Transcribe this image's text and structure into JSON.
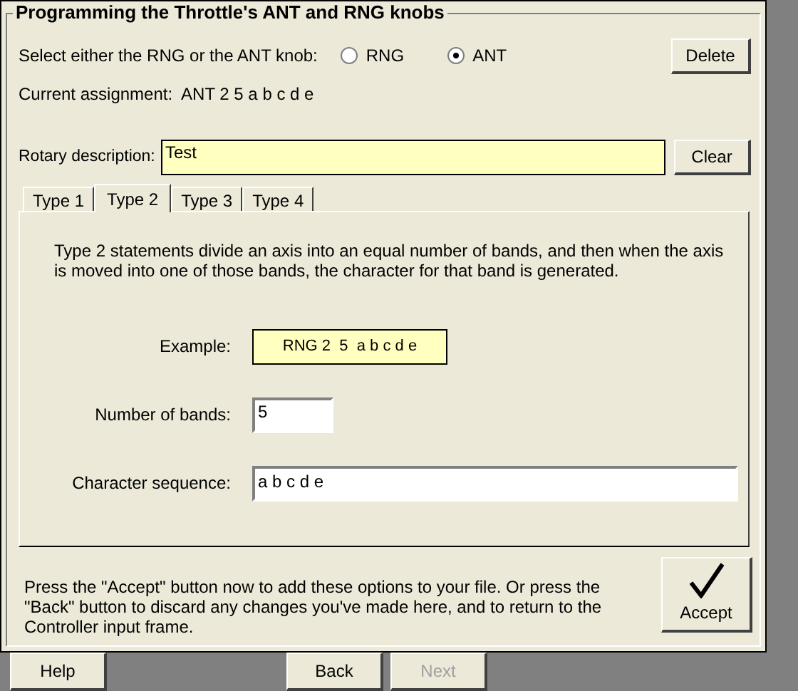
{
  "group_title": "Programming the Throttle's ANT and RNG knobs",
  "knob_select": {
    "label": "Select either the RNG or the ANT knob:",
    "options": [
      {
        "label": "RNG",
        "selected": false
      },
      {
        "label": "ANT",
        "selected": true
      }
    ]
  },
  "delete_button": "Delete",
  "current_assignment": {
    "label": "Current assignment:",
    "value": "ANT 2 5 a b c d e"
  },
  "rotary_description": {
    "label": "Rotary description:",
    "value": "Test"
  },
  "clear_button": "Clear",
  "tabs": [
    {
      "label": "Type 1",
      "selected": false
    },
    {
      "label": "Type 2",
      "selected": true
    },
    {
      "label": "Type 3",
      "selected": false
    },
    {
      "label": "Type 4",
      "selected": false
    }
  ],
  "tab_panel": {
    "description": "Type 2 statements divide an axis into an equal number of bands, and then when the axis is moved into one of those bands, the character for that band is generated.",
    "example": {
      "label": "Example:",
      "value": "RNG 2  5  a b c d e"
    },
    "number_of_bands": {
      "label": "Number of bands:",
      "value": "5"
    },
    "character_sequence": {
      "label": "Character sequence:",
      "value": "a b c d e"
    }
  },
  "instructions": "Press the \"Accept\" button now to add these options to your file.  Or press the \"Back\" button to discard any changes you've made here, and to return to the Controller input frame.",
  "accept_button": "Accept",
  "nav_buttons": [
    {
      "label": "Help",
      "disabled": false
    },
    {
      "label": "Back",
      "disabled": false
    },
    {
      "label": "Next",
      "disabled": true
    }
  ]
}
